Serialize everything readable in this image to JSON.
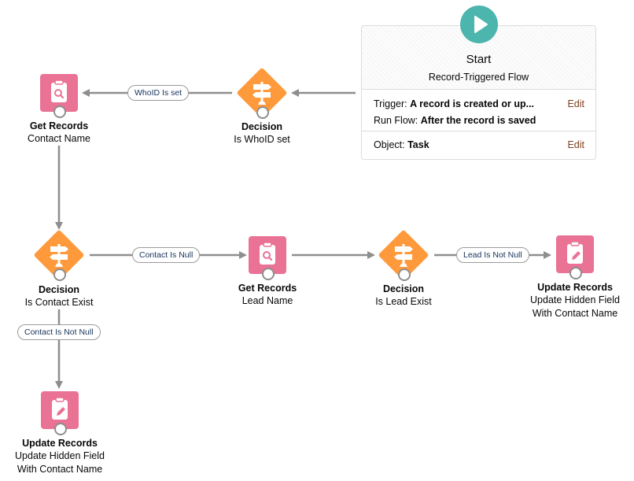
{
  "start": {
    "title": "Start",
    "subtitle": "Record-Triggered Flow",
    "trigger_label": "Trigger:",
    "trigger_value": "A record is created or up...",
    "run_flow_label": "Run Flow:",
    "run_flow_value": "After the record is saved",
    "object_label": "Object:",
    "object_value": "Task",
    "edit_label": "Edit",
    "icon": "play-icon",
    "color": "#4bb5ae"
  },
  "nodes": {
    "decision_whoid": {
      "type": "Decision",
      "name": "Is WhoID set",
      "icon": "decision-signpost-icon"
    },
    "get_contact": {
      "type": "Get Records",
      "name": "Contact Name",
      "icon": "clipboard-search-icon"
    },
    "decision_contact": {
      "type": "Decision",
      "name": "Is Contact Exist",
      "icon": "decision-signpost-icon"
    },
    "get_lead": {
      "type": "Get Records",
      "name": "Lead Name",
      "icon": "clipboard-search-icon"
    },
    "decision_lead": {
      "type": "Decision",
      "name": "Is Lead Exist",
      "icon": "decision-signpost-icon"
    },
    "update_right": {
      "type": "Update Records",
      "name_line1": "Update Hidden Field",
      "name_line2": "With Contact Name",
      "icon": "clipboard-pencil-icon"
    },
    "update_bottom": {
      "type": "Update Records",
      "name_line1": "Update Hidden Field",
      "name_line2": "With Contact Name",
      "icon": "clipboard-pencil-icon"
    }
  },
  "connectors": {
    "whoid_is_set": "WhoID Is set",
    "contact_is_null": "Contact Is Null",
    "contact_is_not_null": "Contact Is Not Null",
    "lead_is_not_null": "Lead Is Not Null"
  },
  "colors": {
    "records": "#ea7295",
    "decision": "#ff9a3c",
    "connector": "#8e8e8e",
    "edit_link": "#7c3f20"
  }
}
